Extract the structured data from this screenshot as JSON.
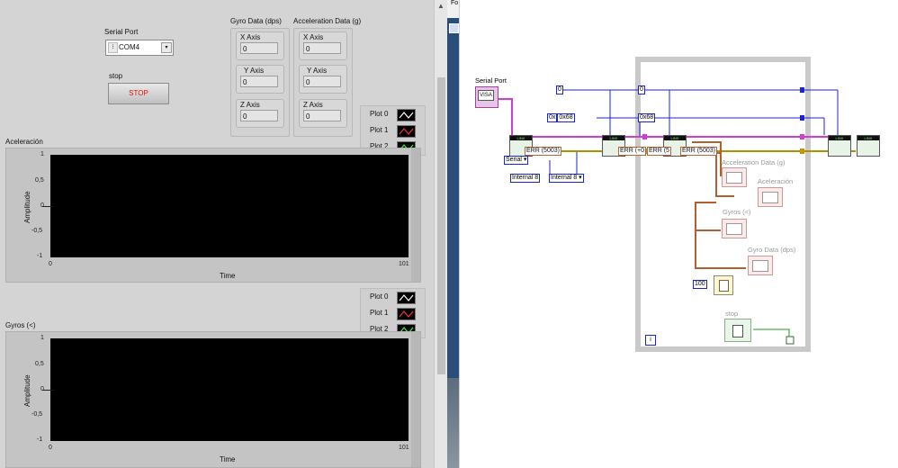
{
  "front_panel": {
    "serial_port": {
      "label": "Serial Port",
      "value": "COM4"
    },
    "stop": {
      "label": "stop",
      "button_text": "STOP"
    },
    "gyro": {
      "title": "Gyro  Data (dps)",
      "x_label": "X Axis",
      "x_value": "0",
      "y_label": "Y Axis",
      "y_value": "0",
      "z_label": "Z Axis",
      "z_value": "0"
    },
    "accel": {
      "title": "Acceleration Data (g)",
      "x_label": "X Axis",
      "x_value": "0",
      "y_label": "Y Axis",
      "y_value": "0",
      "z_label": "Z Axis",
      "z_value": "0"
    },
    "legend_top": [
      "Plot 0",
      "Plot 1",
      "Plot 2"
    ],
    "legend_bottom": [
      "Plot 0",
      "Plot 1",
      "Plot 2"
    ],
    "chart_top": {
      "title": "Aceleración",
      "ylabel": "Amplitude",
      "xlabel": "Time",
      "yticks": [
        "1",
        "0,5",
        "0",
        "-0,5",
        "-1"
      ],
      "xmin": "0",
      "xmax": "101"
    },
    "chart_bottom": {
      "title": "Gyros (<)",
      "ylabel": "Amplitude",
      "xlabel": "Time",
      "yticks": [
        "1",
        "0,5",
        "0",
        "-0,5",
        "-1"
      ],
      "xmin": "0",
      "xmax": "101"
    },
    "plot_colors": {
      "plot0": "#ffffff",
      "plot1": "#ff3030",
      "plot2": "#30ff30"
    }
  },
  "chart_data": [
    {
      "type": "line",
      "title": "Aceleración",
      "xlabel": "Time",
      "ylabel": "Amplitude",
      "xlim": [
        0,
        101
      ],
      "ylim": [
        -1,
        1
      ],
      "series": [
        {
          "name": "Plot 0",
          "values": []
        },
        {
          "name": "Plot 1",
          "values": []
        },
        {
          "name": "Plot 2",
          "values": []
        }
      ]
    },
    {
      "type": "line",
      "title": "Gyros (<)",
      "xlabel": "Time",
      "ylabel": "Amplitude",
      "xlim": [
        0,
        101
      ],
      "ylim": [
        -1,
        1
      ],
      "series": [
        {
          "name": "Plot 0",
          "values": []
        },
        {
          "name": "Plot 1",
          "values": []
        },
        {
          "name": "Plot 2",
          "values": []
        }
      ]
    }
  ],
  "block_diagram": {
    "serial_port_label": "Serial Port",
    "visa_label": "VISA",
    "serial_enum": "Serial",
    "internal_enum_1": "Internal 8",
    "internal_enum_2": "Internal 8",
    "const_0a": "0",
    "const_0b": "0",
    "hex_const_a": "0x68",
    "hex_const_b": "0x68",
    "hex_prefix": "0x",
    "err_1": "ERR (5003)",
    "err_2": "ERR (+0",
    "err_3": "ERR (5",
    "err_4": "ERR (5003)",
    "accel_indicator": "Acceleration Data (g)",
    "aceleracion_indicator": "Aceleración",
    "gyros_indicator": "Gyros (<)",
    "gyro_data_indicator": "Gyro  Data (dps)",
    "wait_const": "100",
    "stop_label": "stop",
    "loop_iter": "i",
    "linx_tag": "LINX",
    "tab_partial": "Fo"
  }
}
